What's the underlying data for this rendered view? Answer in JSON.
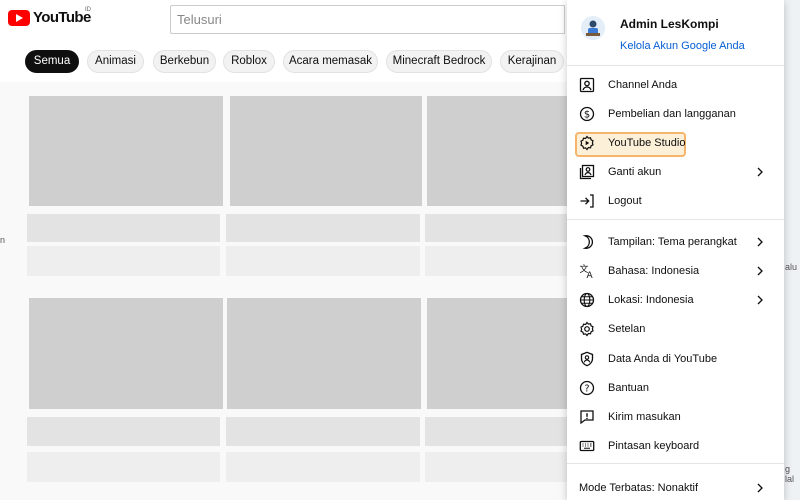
{
  "header": {
    "logo_text": "YouTube",
    "region": "ID",
    "search_placeholder": "Telusuri"
  },
  "chips": [
    {
      "label": "Semua",
      "active": true
    },
    {
      "label": "Animasi"
    },
    {
      "label": "Berkebun"
    },
    {
      "label": "Roblox"
    },
    {
      "label": "Acara memasak"
    },
    {
      "label": "Minecraft Bedrock"
    },
    {
      "label": "Kerajinan"
    }
  ],
  "background_fragments": {
    "left_edge": "n",
    "right_top": "alu",
    "right_bottom": "g lal"
  },
  "menu": {
    "account_name": "Admin LesKompi",
    "manage_link": "Kelola Akun Google Anda",
    "items": [
      {
        "label": "Channel Anda",
        "icon": "channel-icon"
      },
      {
        "label": "Pembelian dan langganan",
        "icon": "dollar-icon"
      },
      {
        "label": "YouTube Studio",
        "icon": "studio-gear-icon",
        "highlighted": true
      },
      {
        "label": "Ganti akun",
        "icon": "switch-account-icon",
        "submenu": true
      },
      {
        "label": "Logout",
        "icon": "logout-icon"
      },
      {
        "label": "Tampilan: Tema perangkat",
        "icon": "moon-icon",
        "submenu": true
      },
      {
        "label": "Bahasa: Indonesia",
        "icon": "translate-icon",
        "submenu": true
      },
      {
        "label": "Lokasi: Indonesia",
        "icon": "globe-icon",
        "submenu": true
      },
      {
        "label": "Setelan",
        "icon": "settings-icon"
      },
      {
        "label": "Data Anda di YouTube",
        "icon": "shield-person-icon"
      },
      {
        "label": "Bantuan",
        "icon": "help-icon"
      },
      {
        "label": "Kirim masukan",
        "icon": "feedback-icon"
      },
      {
        "label": "Pintasan keyboard",
        "icon": "keyboard-icon"
      },
      {
        "label": "Mode Terbatas: Nonaktif",
        "icon": "",
        "submenu": true
      }
    ]
  },
  "colors": {
    "brand_red": "#ff0000",
    "link_blue": "#065fd4",
    "highlight_border": "#f5b66b",
    "highlight_fill": "#fdf0d9"
  }
}
